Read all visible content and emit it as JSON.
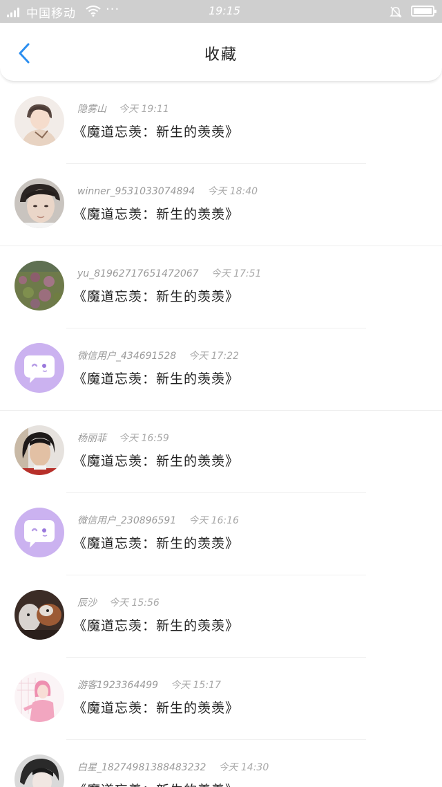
{
  "status_bar": {
    "carrier": "中国移动",
    "dots": "···",
    "time": "19:15"
  },
  "header": {
    "title": "收藏",
    "back_icon": "chevron-left-icon"
  },
  "colors": {
    "accent": "#2b8ef0",
    "statusbar_bg": "#cfcfcf",
    "wechat_avatar_bg": "#cbb2f0"
  },
  "favorites": [
    {
      "user": "隐雾山",
      "time": "今天 19:11",
      "content": "《魔道忘羡：新生的羡羡》",
      "avatar": "anime-boy-avatar"
    },
    {
      "user": "winner_9531033074894",
      "time": "今天 18:40",
      "content": "《魔道忘羡：新生的羡羡》",
      "avatar": "man-portrait-avatar"
    },
    {
      "user": "yu_81962717651472067",
      "time": "今天 17:51",
      "content": "《魔道忘羡：新生的羡羡》",
      "avatar": "flowers-avatar"
    },
    {
      "user": "微信用户_434691528",
      "time": "今天 17:22",
      "content": "《魔道忘羡：新生的羡羡》",
      "avatar": "wechat-default-avatar"
    },
    {
      "user": "杨丽菲",
      "time": "今天 16:59",
      "content": "《魔道忘羡：新生的羡羡》",
      "avatar": "girl-portrait-avatar"
    },
    {
      "user": "微信用户_230896591",
      "time": "今天 16:16",
      "content": "《魔道忘羡：新生的羡羡》",
      "avatar": "wechat-default-avatar"
    },
    {
      "user": "辰沙",
      "time": "今天 15:56",
      "content": "《魔道忘羡：新生的羡羡》",
      "avatar": "dogs-avatar"
    },
    {
      "user": "游客1923364499",
      "time": "今天 15:17",
      "content": "《魔道忘羡：新生的羡羡》",
      "avatar": "pink-girl-avatar"
    },
    {
      "user": "白星_18274981388483232",
      "time": "今天 14:30",
      "content": "《魔道忘羡：新生的羡羡》",
      "avatar": "dark-anime-avatar"
    }
  ]
}
